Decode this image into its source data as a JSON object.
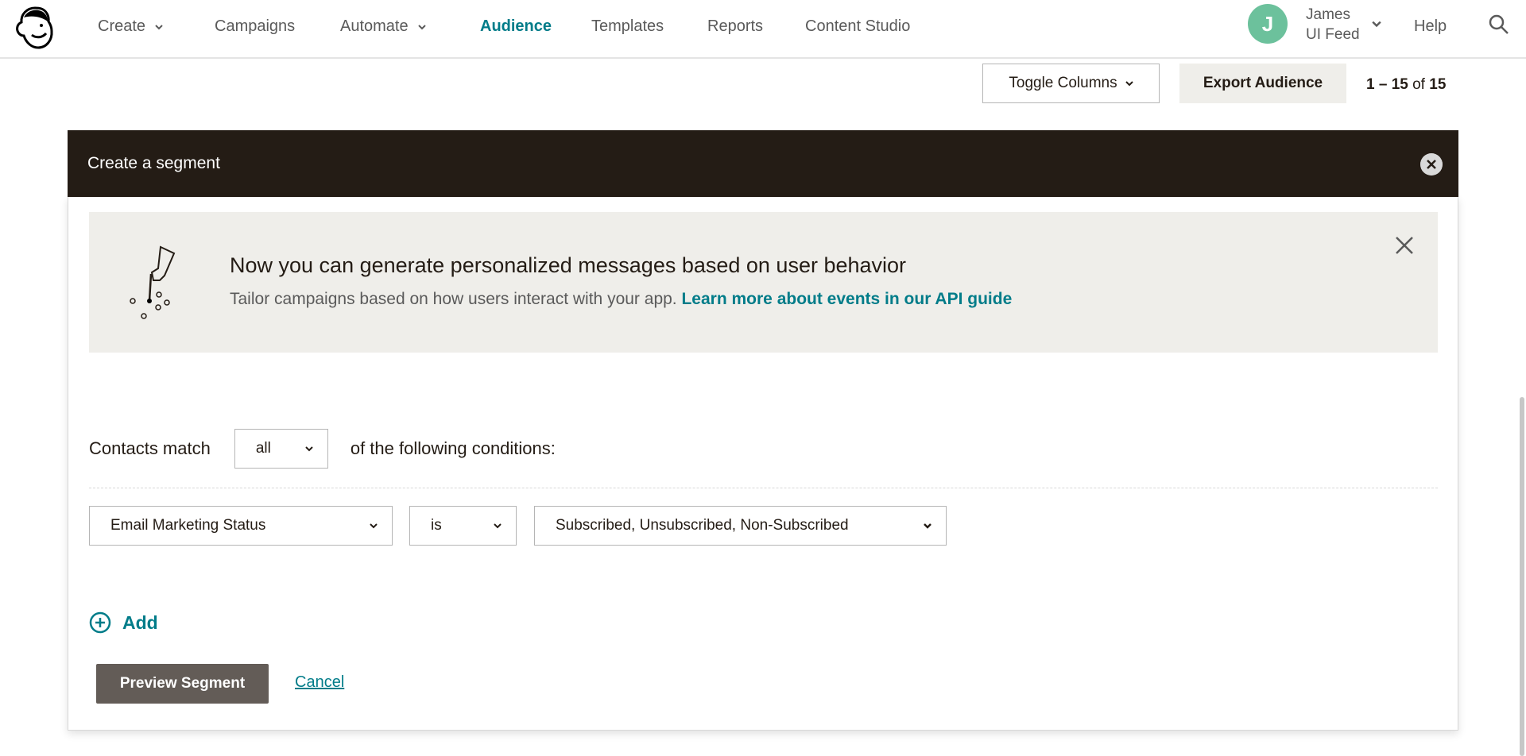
{
  "nav": {
    "items": [
      {
        "label": "Create",
        "dropdown": true
      },
      {
        "label": "Campaigns",
        "dropdown": false
      },
      {
        "label": "Automate",
        "dropdown": true
      },
      {
        "label": "Audience",
        "dropdown": false,
        "active": true
      },
      {
        "label": "Templates",
        "dropdown": false
      },
      {
        "label": "Reports",
        "dropdown": false
      },
      {
        "label": "Content Studio",
        "dropdown": false
      }
    ],
    "user": {
      "initial": "J",
      "name_line1": "James",
      "name_line2": "UI Feed"
    },
    "help": "Help",
    "accent": "#007c89"
  },
  "toolbar": {
    "toggle_columns": "Toggle Columns",
    "export": "Export Audience",
    "count_range": "1 – 15",
    "count_of": "of",
    "count_total": "15"
  },
  "modal": {
    "title": "Create a segment",
    "banner": {
      "title": "Now you can generate personalized messages based on user behavior",
      "text": "Tailor campaigns based on how users interact with your app.",
      "link": "Learn more about events in our API guide"
    },
    "match_prefix": "Contacts match",
    "match_value": "all",
    "match_suffix": "of the following conditions:",
    "condition": {
      "field": "Email Marketing Status",
      "operator": "is",
      "value": "Subscribed, Unsubscribed, Non-Subscribed"
    },
    "add": "Add",
    "preview": "Preview Segment",
    "cancel": "Cancel"
  }
}
